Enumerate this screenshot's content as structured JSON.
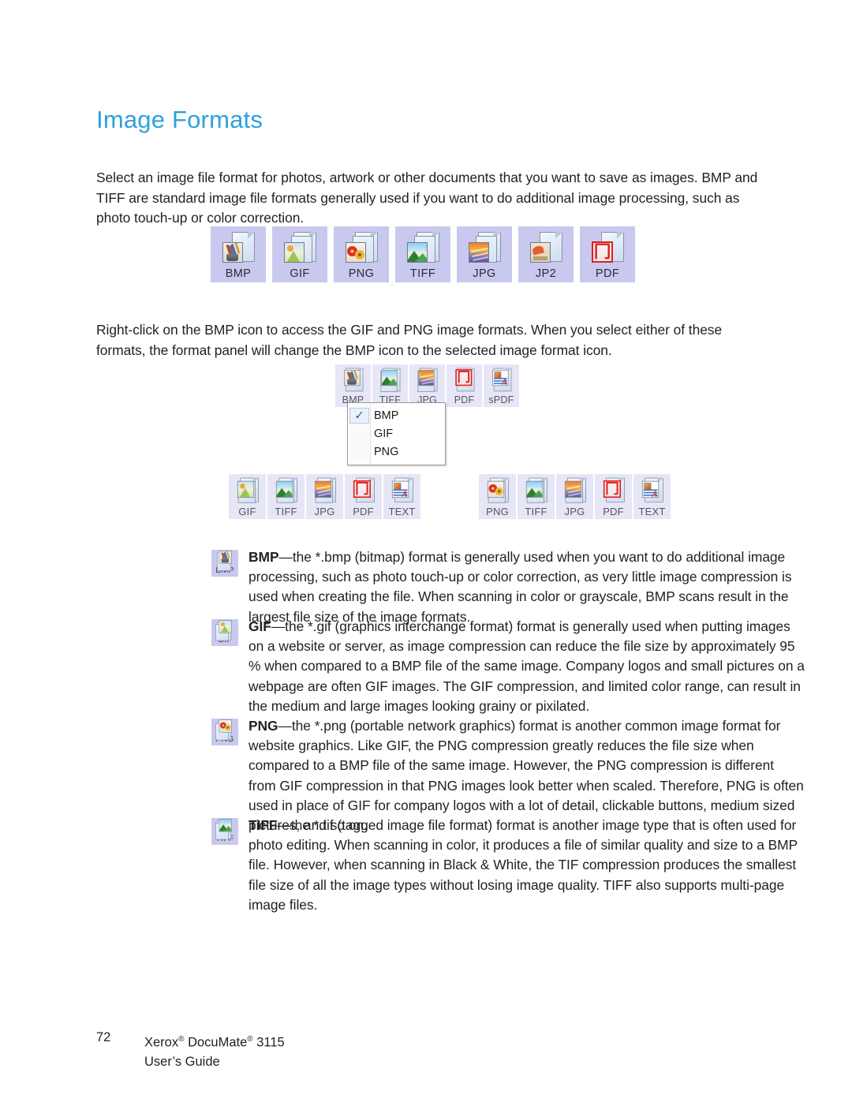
{
  "heading": "Image Formats",
  "paragraphs": {
    "intro": "Select an image file format for photos, artwork or other documents that you want to save as images. BMP and TIFF are standard image file formats generally used if you want to do additional image processing, such as photo touch-up or color correction.",
    "rightclick": "Right-click on the BMP icon to access the GIF and PNG image formats. When you select either of these formats, the format panel will change the BMP icon to the selected image format icon."
  },
  "format_strip_top": [
    {
      "label": "BMP",
      "icon": "bmp-format-icon"
    },
    {
      "label": "GIF",
      "icon": "gif-format-icon"
    },
    {
      "label": "PNG",
      "icon": "png-format-icon"
    },
    {
      "label": "TIFF",
      "icon": "tiff-format-icon"
    },
    {
      "label": "JPG",
      "icon": "jpg-format-icon"
    },
    {
      "label": "JP2",
      "icon": "jp2-format-icon"
    },
    {
      "label": "PDF",
      "icon": "pdf-format-icon"
    }
  ],
  "context_illustration": {
    "panel_items": [
      {
        "label": "BMP"
      },
      {
        "label": "TIFF"
      },
      {
        "label": "JPG"
      },
      {
        "label": "PDF"
      },
      {
        "label": "sPDF"
      }
    ],
    "menu": {
      "items": [
        {
          "label": "BMP",
          "checked": true,
          "check_glyph": "✓"
        },
        {
          "label": "GIF",
          "checked": false
        },
        {
          "label": "PNG",
          "checked": false
        }
      ]
    }
  },
  "result_rows": [
    {
      "name": "gif-selected-panel",
      "items": [
        {
          "label": "GIF"
        },
        {
          "label": "TIFF"
        },
        {
          "label": "JPG"
        },
        {
          "label": "PDF"
        },
        {
          "label": "TEXT"
        }
      ]
    },
    {
      "name": "png-selected-panel",
      "items": [
        {
          "label": "PNG"
        },
        {
          "label": "TIFF"
        },
        {
          "label": "JPG"
        },
        {
          "label": "PDF"
        },
        {
          "label": "TEXT"
        }
      ]
    }
  ],
  "descriptions": [
    {
      "icon_label": "BMP",
      "term": "BMP",
      "body": "—the *.bmp (bitmap) format is generally used when you want to do additional image processing, such as photo touch-up or color correction, as very little image compression is used when creating the file. When scanning in color or grayscale, BMP scans result in the largest file size of the image formats."
    },
    {
      "icon_label": "GIF",
      "term": "GIF",
      "body": "—the *.gif (graphics interchange format) format is generally used when putting images on a website or server, as image compression can reduce the file size by approximately 95 % when compared to a BMP file of the same image. Company logos and small pictures on a webpage are often GIF images. The GIF compression, and limited color range, can result in the medium and large images looking grainy or pixilated."
    },
    {
      "icon_label": "PNG",
      "term": "PNG",
      "body": "—the *.png (portable network graphics) format is another common image format for website graphics. Like GIF, the PNG compression greatly reduces the file size when compared to a BMP file of the same image. However, the PNG compression is different from GIF compression in that PNG images look better when scaled. Therefore, PNG is often used in place of GIF for company logos with a lot of detail, clickable buttons, medium sized pictures, and so on."
    },
    {
      "icon_label": "TIFF",
      "term": "TIFF",
      "body": "—the *.tif (tagged image file format) format is another image type that is often used for photo editing. When scanning in color, it produces a file of similar quality and size to a BMP file. However, when scanning in Black & White, the TIF compression produces the smallest file size of all the image types without losing image quality. TIFF also supports multi-page image files."
    }
  ],
  "footer": {
    "page_number": "72",
    "product_pre": "Xerox",
    "product_mid": " DocuMate",
    "product_post": " 3115",
    "reg_mark": "®",
    "guide_line": "User’s Guide"
  },
  "colors": {
    "heading": "#2fa0dc",
    "panel_bg_strong": "#c9c8ee",
    "panel_bg_light": "#e6e6f7",
    "text": "#231f20",
    "pdf_red": "#e02020",
    "check_blue": "#2b5fb0"
  }
}
